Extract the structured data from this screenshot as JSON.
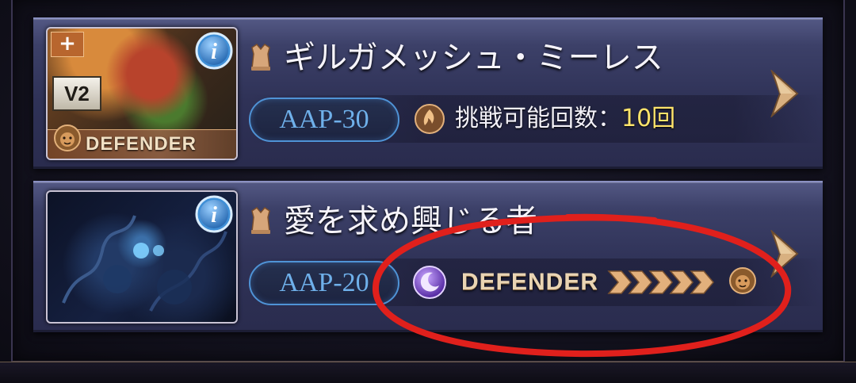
{
  "colors": {
    "card_top": "#535884",
    "card_bottom": "#2a2c4e",
    "aap_blue": "#6fb0ea",
    "attempt_value_yellow": "#ffe46b",
    "defender_tan": "#e9d4b3",
    "annotation_red": "#e0201c"
  },
  "quests": [
    {
      "title": "ギルガメッシュ・ミーレス",
      "title_icon": "pawn-icon",
      "portrait": {
        "plus_badge": "+",
        "version_badge": "V2",
        "role_label": "DEFENDER",
        "role_icon": "lion-icon",
        "info_icon": "info-icon"
      },
      "aap": "AAP-30",
      "attempts_icon": "flame-orb-icon",
      "attempts_label": "挑戦可能回数：",
      "attempts_value": "10回",
      "nav_icon": "chevron-right-icon"
    },
    {
      "title": "愛を求め興じる者",
      "title_icon": "pawn-icon",
      "portrait": {
        "info_icon": "info-icon"
      },
      "aap": "AAP-20",
      "element_icon": "dark-orb-icon",
      "role_label": "DEFENDER",
      "role_level_icon": "chevron-rank-icon",
      "role_level": 5,
      "role_icon": "lion-icon",
      "nav_icon": "chevron-right-icon"
    }
  ],
  "annotation": {
    "type": "hand-drawn red circle",
    "target": "second quest DEFENDER requirement"
  }
}
